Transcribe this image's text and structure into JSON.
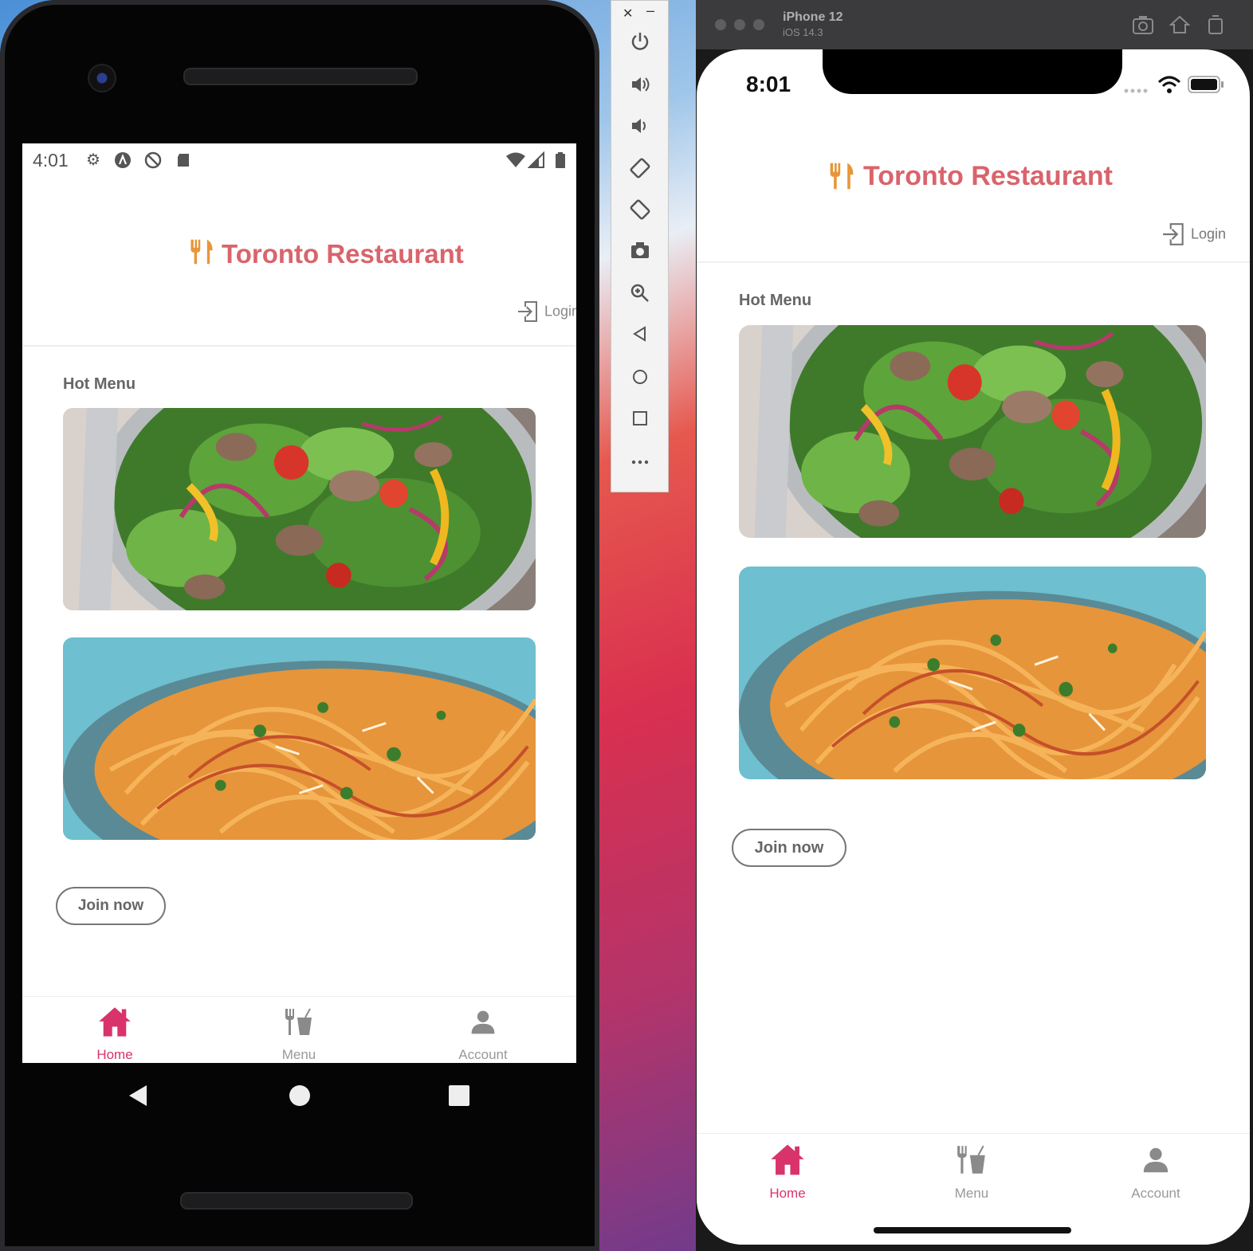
{
  "colors": {
    "brand": "#d9646c",
    "logo": "#e8963a",
    "tab_active": "#d9336b",
    "tab_inactive": "#999999"
  },
  "app": {
    "title": "Toronto Restaurant",
    "logo_icon": "fork-knife-icon",
    "login_label": "Login",
    "section_title": "Hot Menu",
    "menu_images": [
      "salad-image",
      "spaghetti-image"
    ],
    "join_label": "Join now",
    "tabs": [
      {
        "label": "Home",
        "icon": "home-icon",
        "active": true
      },
      {
        "label": "Menu",
        "icon": "utensils-drink-icon",
        "active": false
      },
      {
        "label": "Account",
        "icon": "person-icon",
        "active": false
      }
    ]
  },
  "android": {
    "status_time": "4:01"
  },
  "ios": {
    "device_name": "iPhone 12",
    "os_version": "iOS 14.3",
    "status_time": "8:01"
  }
}
